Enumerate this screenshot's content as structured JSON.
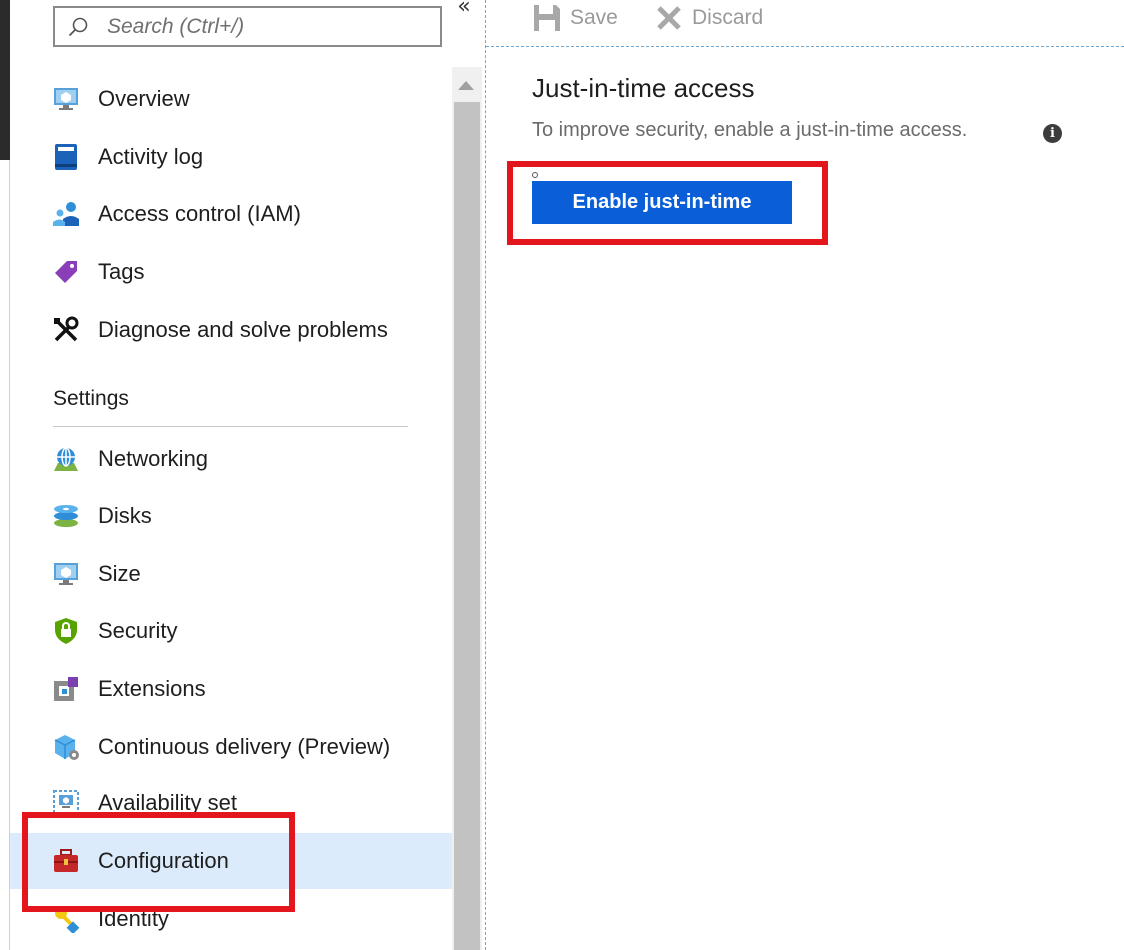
{
  "search": {
    "placeholder": "Search (Ctrl+/)",
    "value": ""
  },
  "sidebar": {
    "collapse_glyph": "«",
    "top_items": [
      {
        "label": "Overview",
        "icon": "vm-monitor-icon"
      },
      {
        "label": "Activity log",
        "icon": "activity-log-icon"
      },
      {
        "label": "Access control (IAM)",
        "icon": "iam-users-icon"
      },
      {
        "label": "Tags",
        "icon": "tag-icon"
      },
      {
        "label": "Diagnose and solve problems",
        "icon": "tools-icon"
      }
    ],
    "settings_title": "Settings",
    "settings_items": [
      {
        "label": "Networking",
        "icon": "network-globe-icon"
      },
      {
        "label": "Disks",
        "icon": "disks-icon"
      },
      {
        "label": "Size",
        "icon": "vm-monitor-icon"
      },
      {
        "label": "Security",
        "icon": "shield-lock-icon"
      },
      {
        "label": "Extensions",
        "icon": "extensions-icon"
      },
      {
        "label": "Continuous delivery (Preview)",
        "icon": "continuous-delivery-icon"
      },
      {
        "label": "Availability set",
        "icon": "availability-set-icon"
      },
      {
        "label": "Configuration",
        "icon": "toolbox-icon",
        "selected": true
      },
      {
        "label": "Identity",
        "icon": "key-identity-icon"
      }
    ]
  },
  "toolbar": {
    "save_label": "Save",
    "discard_label": "Discard"
  },
  "main": {
    "title": "Just-in-time access",
    "description": "To improve security, enable a just-in-time access.",
    "info_glyph": "i",
    "enable_button_label": "Enable just-in-time"
  },
  "colors": {
    "accent_button": "#0a5fd8",
    "selected_row": "#dcebfb",
    "highlight_box": "#e3161e"
  }
}
